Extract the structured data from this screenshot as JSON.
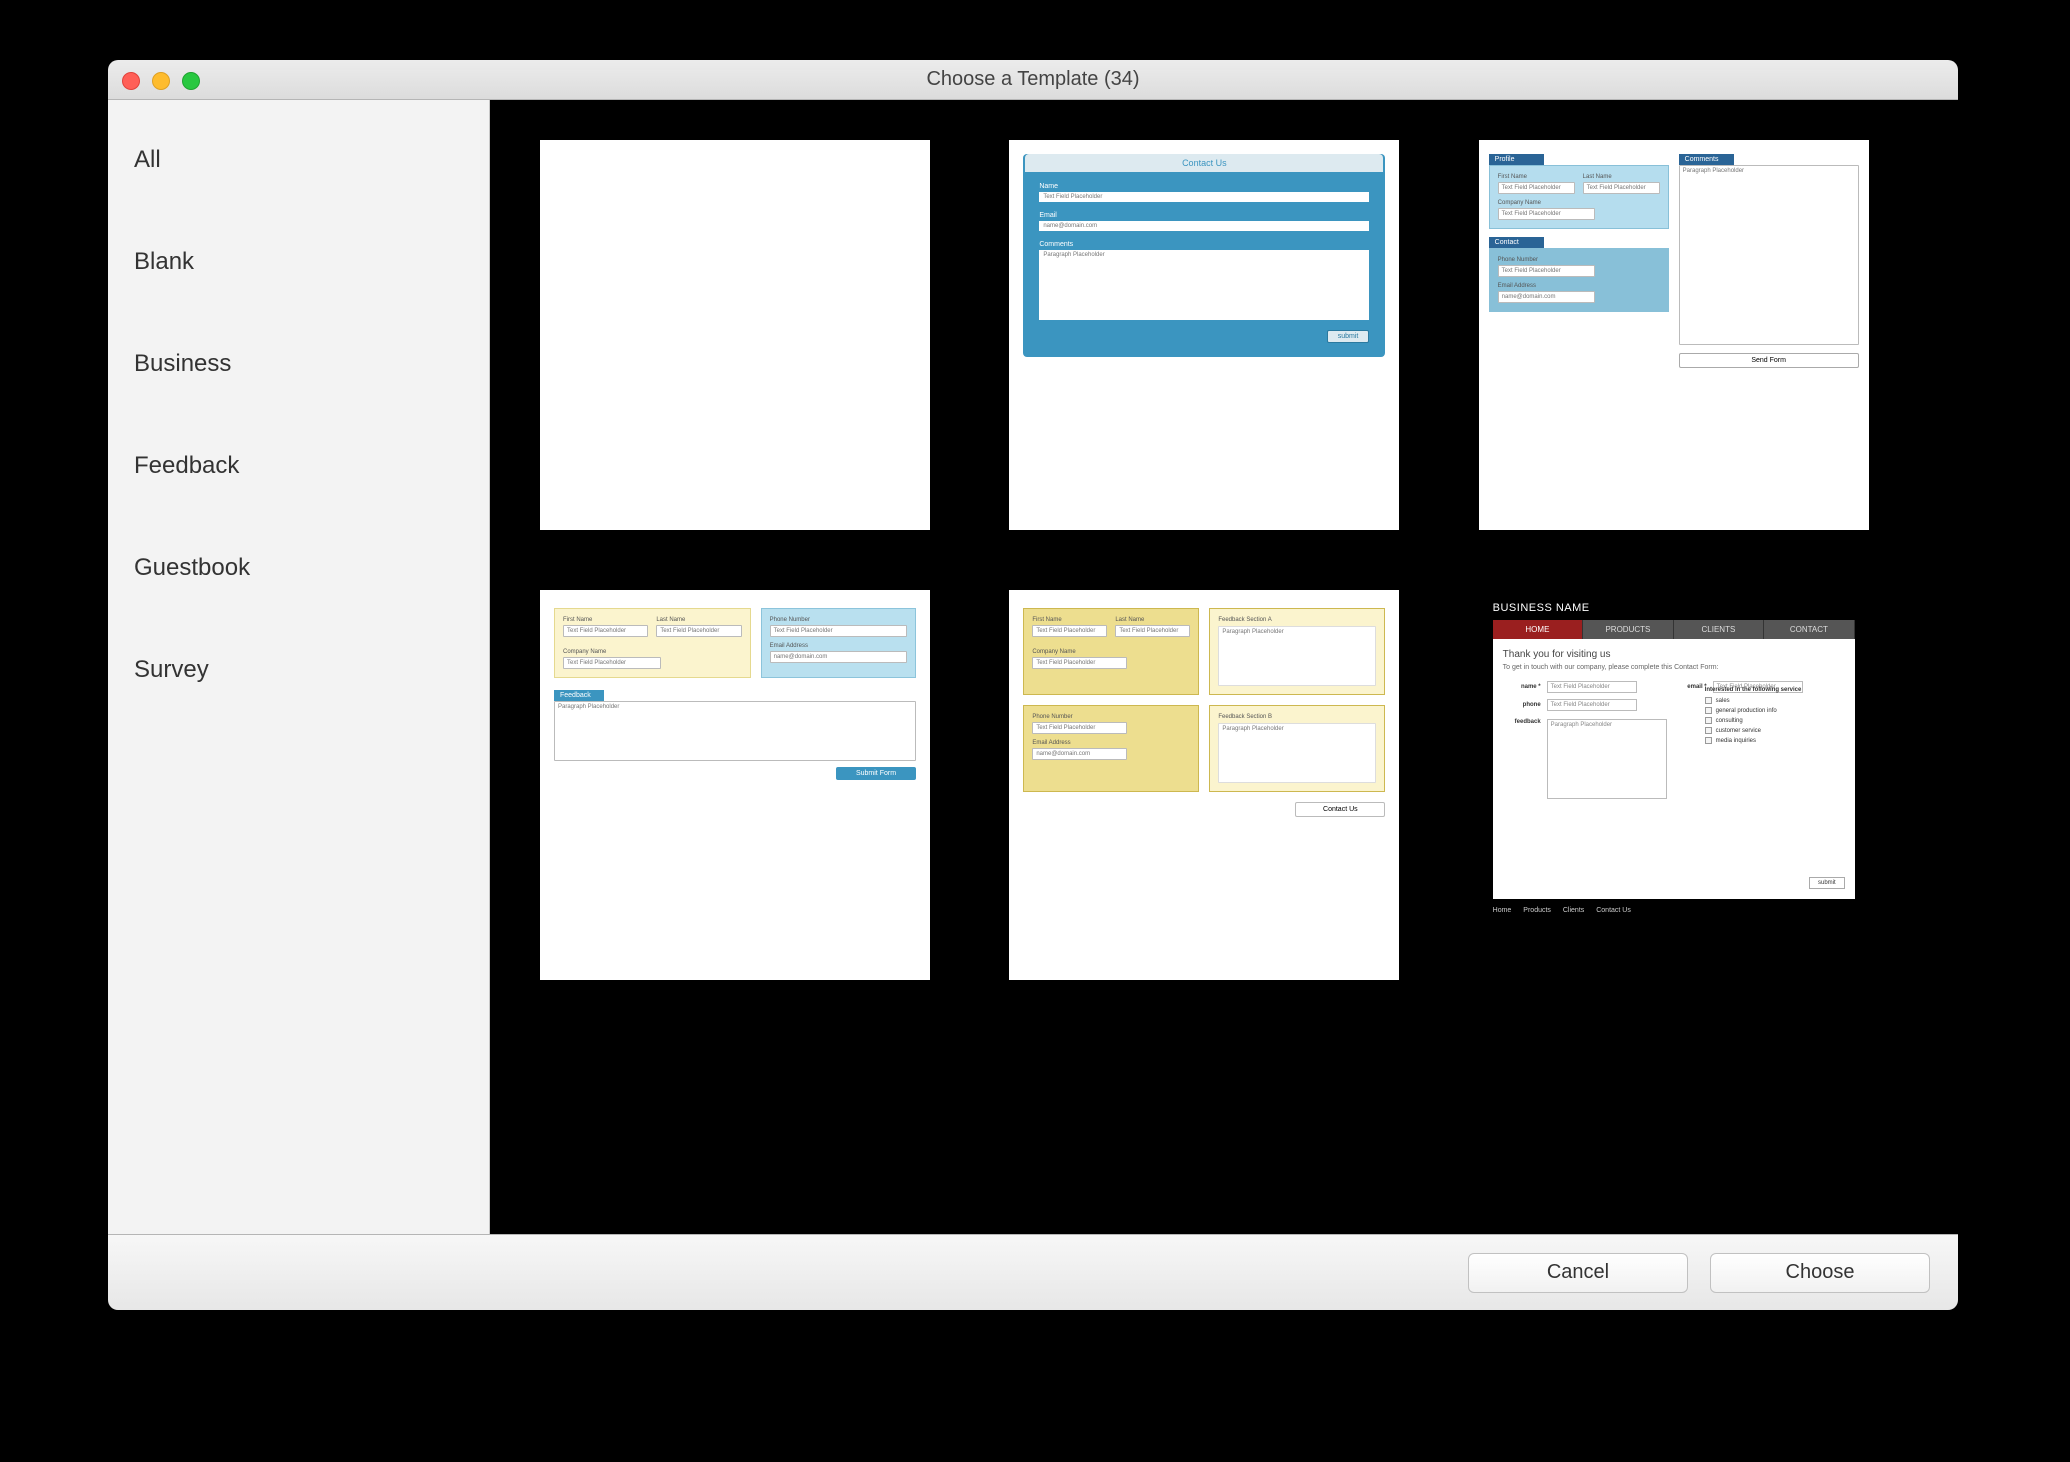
{
  "window": {
    "title": "Choose a Template (34)"
  },
  "sidebar": {
    "items": [
      {
        "label": "All"
      },
      {
        "label": "Blank"
      },
      {
        "label": "Business"
      },
      {
        "label": "Feedback"
      },
      {
        "label": "Guestbook"
      },
      {
        "label": "Survey"
      }
    ]
  },
  "footer": {
    "cancel": "Cancel",
    "choose": "Choose"
  },
  "thumbs": {
    "t2": {
      "title": "Contact Us",
      "name_label": "Name",
      "name_ph": "Text Field Placeholder",
      "email_label": "Email",
      "email_ph": "name@domain.com",
      "comments_label": "Comments",
      "comments_ph": "Paragraph Placeholder",
      "submit": "submit"
    },
    "t3": {
      "profile_title": "Profile",
      "first_name": "First Name",
      "last_name": "Last Name",
      "tf_ph": "Text Field Placeholder",
      "company": "Company Name",
      "contact_title": "Contact",
      "phone": "Phone Number",
      "email": "Email Address",
      "email_ph": "name@domain.com",
      "comments_title": "Comments",
      "comments_ph": "Paragraph Placeholder",
      "send": "Send Form"
    },
    "t4": {
      "first_name": "First Name",
      "last_name": "Last Name",
      "tf_ph": "Text Field Placeholder",
      "company": "Company Name",
      "phone": "Phone Number",
      "email": "Email Address",
      "email_ph": "name@domain.com",
      "feedback_title": "Feedback",
      "feedback_ph": "Paragraph Placeholder",
      "submit": "Submit Form"
    },
    "t5": {
      "first_name": "First Name",
      "last_name": "Last Name",
      "tf_ph": "Text Field Placeholder",
      "company": "Company Name",
      "phone": "Phone Number",
      "email": "Email Address",
      "email_ph": "name@domain.com",
      "section_a": "Feedback Section A",
      "section_b": "Feedback Section B",
      "para_ph": "Paragraph Placeholder",
      "contact": "Contact Us"
    },
    "t6": {
      "brand": "BUSINESS NAME",
      "nav": [
        "HOME",
        "PRODUCTS",
        "CLIENTS",
        "CONTACT"
      ],
      "thanks": "Thank you for visiting us",
      "sub": "To get in touch with our company, please complete this Contact Form:",
      "name_label": "name *",
      "email_label": "email *",
      "phone_label": "phone",
      "feedback_label": "feedback",
      "tf_ph": "Text Field Placeholder",
      "para_ph": "Paragraph Placeholder",
      "svc_title": "Interested in the following service",
      "services": [
        "sales",
        "general production info",
        "consulting",
        "customer service",
        "media inquiries"
      ],
      "submit": "submit",
      "footer_links": [
        "Home",
        "Products",
        "Clients",
        "Contact Us"
      ]
    }
  }
}
